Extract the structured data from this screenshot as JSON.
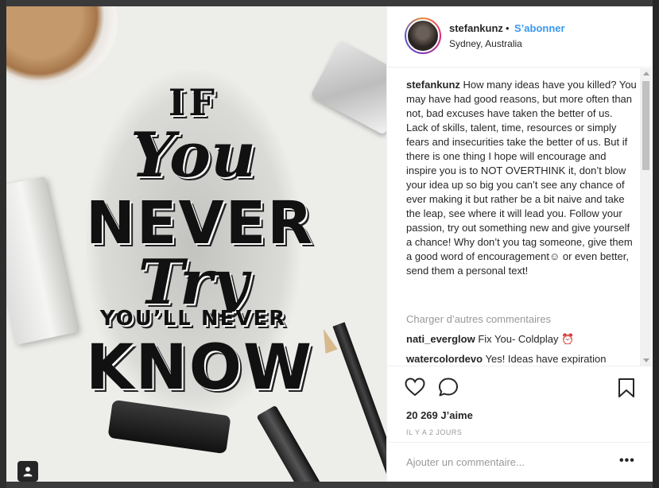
{
  "post": {
    "username": "stefankunz",
    "separator": "•",
    "follow_label": "S’abonner",
    "location": "Sydney, Australia",
    "caption_user": "stefankunz",
    "caption_text": "How many ideas have you killed? You may have had good reasons, but more often than not, bad excuses have taken the better of us. Lack of skills, talent, time, resources or simply fears and insecurities take the better of us. But if there is one thing I hope will encourage and inspire you is to NOT OVERTHINK it, don’t blow your idea up so big you can’t see any chance of ever making it but rather be a bit naive and take the leap, see where it will lead you. Follow your passion, try out something new and give yourself a chance! Why don’t you tag someone, give them a good word of encouragement☺ or even better, send them a personal text!",
    "load_more_label": "Charger d’autres commentaires",
    "comments": [
      {
        "user": "nati_everglow",
        "text": "Fix You- Coldplay ⏰"
      },
      {
        "user": "watercolordevo",
        "text": "Yes! Ideas have expiration"
      }
    ],
    "likes": "20 269 J’aime",
    "time_ago": "IL Y A 2 JOURS",
    "add_comment_placeholder": "Ajouter un commentaire...",
    "more_options": "•••"
  },
  "artwork": {
    "line1": "IF",
    "line2": "You",
    "line3": "NEVER",
    "line4": "Try",
    "line5": "YOU’LL NEVER",
    "line6": "KNOW"
  },
  "icons": {
    "like": "heart-icon",
    "comment": "comment-bubble-icon",
    "save": "bookmark-icon",
    "user": "person-icon"
  },
  "colors": {
    "accent": "#3897f0",
    "text": "#262626",
    "muted": "#999999"
  }
}
